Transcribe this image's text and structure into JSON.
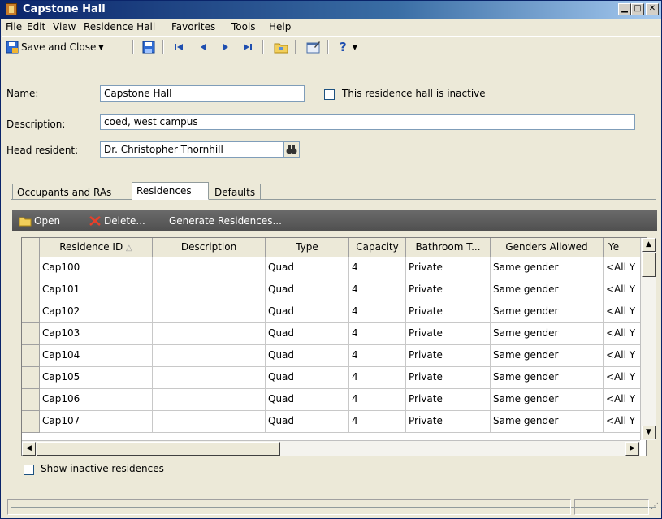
{
  "window": {
    "title": "Capstone Hall"
  },
  "menu": [
    "File",
    "Edit",
    "View",
    "Residence Hall",
    "Favorites",
    "Tools",
    "Help"
  ],
  "toolbar": {
    "save_close": "Save and Close",
    "help_symbol": "?"
  },
  "form": {
    "name_label": "Name:",
    "name_value": "Capstone Hall",
    "inactive_label": "This residence hall is inactive",
    "description_label": "Description:",
    "description_value": "coed, west campus",
    "head_label": "Head resident:",
    "head_value": "Dr. Christopher Thornhill"
  },
  "tabs": [
    "Occupants and RAs",
    "Residences",
    "Defaults"
  ],
  "gridbar": {
    "open": "Open",
    "delete": "Delete...",
    "generate": "Generate Residences..."
  },
  "grid": {
    "columns": [
      "Residence ID",
      "Description",
      "Type",
      "Capacity",
      "Bathroom T...",
      "Genders Allowed",
      "Ye"
    ],
    "rows": [
      [
        "Cap100",
        "",
        "Quad",
        "4",
        "Private",
        "Same gender",
        "<All Y"
      ],
      [
        "Cap101",
        "",
        "Quad",
        "4",
        "Private",
        "Same gender",
        "<All Y"
      ],
      [
        "Cap102",
        "",
        "Quad",
        "4",
        "Private",
        "Same gender",
        "<All Y"
      ],
      [
        "Cap103",
        "",
        "Quad",
        "4",
        "Private",
        "Same gender",
        "<All Y"
      ],
      [
        "Cap104",
        "",
        "Quad",
        "4",
        "Private",
        "Same gender",
        "<All Y"
      ],
      [
        "Cap105",
        "",
        "Quad",
        "4",
        "Private",
        "Same gender",
        "<All Y"
      ],
      [
        "Cap106",
        "",
        "Quad",
        "4",
        "Private",
        "Same gender",
        "<All Y"
      ],
      [
        "Cap107",
        "",
        "Quad",
        "4",
        "Private",
        "Same gender",
        "<All Y"
      ]
    ]
  },
  "footer": {
    "show_inactive": "Show inactive residences"
  },
  "colors": {
    "title_start": "#0a246a",
    "title_end": "#a6caf0",
    "gridbar": "#5a5a5a",
    "delete_x": "#e8402a"
  }
}
